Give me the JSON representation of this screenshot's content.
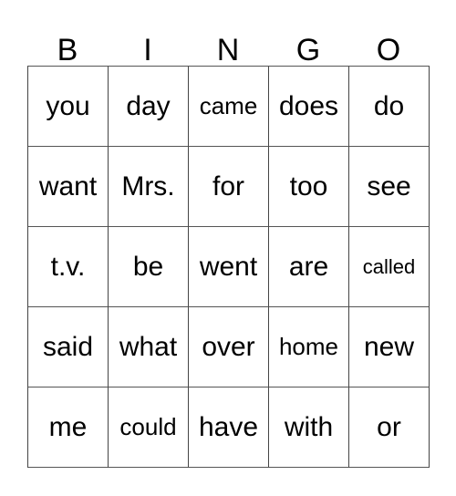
{
  "card": {
    "header": {
      "letters": [
        "B",
        "I",
        "N",
        "G",
        "O"
      ]
    },
    "grid": {
      "rows": 5,
      "columns": 5,
      "cells": [
        [
          {
            "word": "you",
            "size": "lg"
          },
          {
            "word": "day",
            "size": "lg"
          },
          {
            "word": "came",
            "size": "md"
          },
          {
            "word": "does",
            "size": "lg"
          },
          {
            "word": "do",
            "size": "lg"
          }
        ],
        [
          {
            "word": "want",
            "size": "lg"
          },
          {
            "word": "Mrs.",
            "size": "lg"
          },
          {
            "word": "for",
            "size": "lg"
          },
          {
            "word": "too",
            "size": "lg"
          },
          {
            "word": "see",
            "size": "lg"
          }
        ],
        [
          {
            "word": "t.v.",
            "size": "lg"
          },
          {
            "word": "be",
            "size": "lg"
          },
          {
            "word": "went",
            "size": "lg"
          },
          {
            "word": "are",
            "size": "lg"
          },
          {
            "word": "called",
            "size": "sm"
          }
        ],
        [
          {
            "word": "said",
            "size": "lg"
          },
          {
            "word": "what",
            "size": "lg"
          },
          {
            "word": "over",
            "size": "lg"
          },
          {
            "word": "home",
            "size": "md"
          },
          {
            "word": "new",
            "size": "lg"
          }
        ],
        [
          {
            "word": "me",
            "size": "lg"
          },
          {
            "word": "could",
            "size": "md"
          },
          {
            "word": "have",
            "size": "lg"
          },
          {
            "word": "with",
            "size": "lg"
          },
          {
            "word": "or",
            "size": "lg"
          }
        ]
      ]
    },
    "colors": {
      "background": "#ffffff",
      "text": "#000000",
      "border": "#444444"
    }
  }
}
